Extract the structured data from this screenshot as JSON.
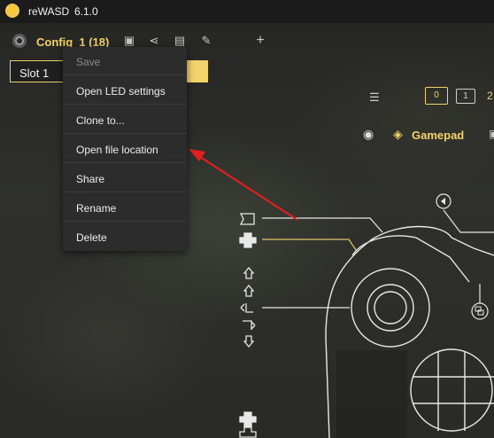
{
  "titlebar": {
    "app_name": "reWASD",
    "version": "6.1.0",
    "logo_glyph": "⚡"
  },
  "config": {
    "name": "Config_1 (18)"
  },
  "slot": {
    "label": "Slot 1"
  },
  "context_menu": {
    "items": [
      {
        "label": "Save",
        "disabled": true
      },
      {
        "label": "Open LED settings",
        "disabled": false
      },
      {
        "label": "Clone to...",
        "disabled": false
      },
      {
        "label": "Open file location",
        "disabled": false
      },
      {
        "label": "Share",
        "disabled": false
      },
      {
        "label": "Rename",
        "disabled": false
      },
      {
        "label": "Delete",
        "disabled": false
      }
    ]
  },
  "shift_selector": {
    "active": "0",
    "next": "1",
    "extra": "2"
  },
  "view": {
    "device_label": "Gamepad"
  },
  "colors": {
    "accent": "#f2d26a",
    "arrow": "#e02020",
    "line": "#e8e8e8"
  }
}
